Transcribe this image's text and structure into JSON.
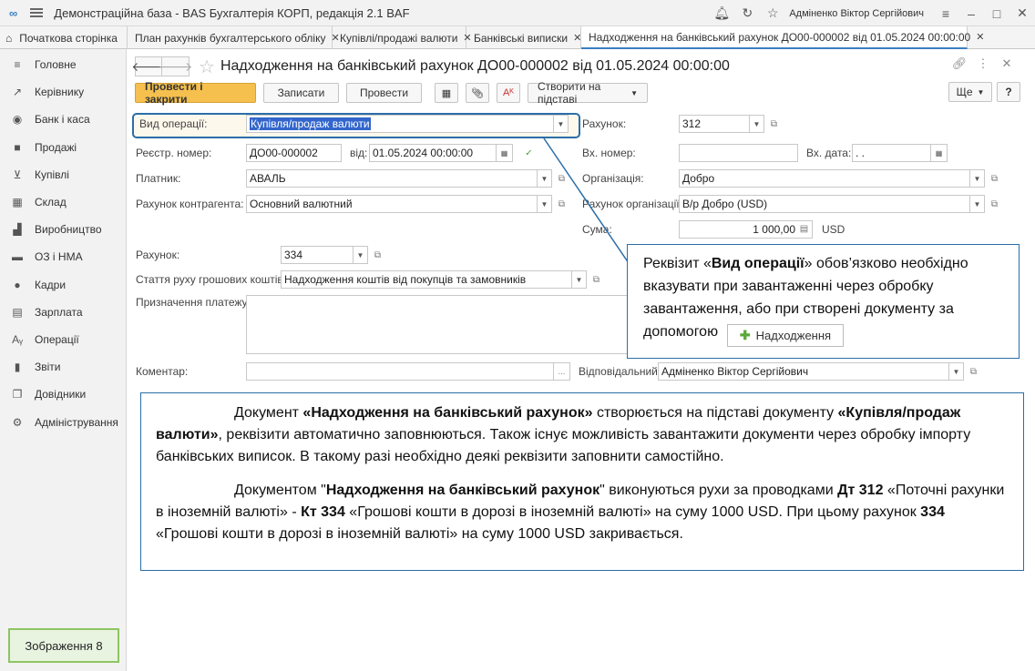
{
  "app": {
    "title": "Демонстраційна база - BAS Бухгалтерія КОРП, редакція 2.1 BAF",
    "user": "Адміненко Віктор Сергійович",
    "logo_text": "∞"
  },
  "tabs": [
    {
      "label": "Початкова сторінка",
      "icon": "home-icon"
    },
    {
      "label": "План рахунків бухгалтерського обліку"
    },
    {
      "label": "Купівлі/продажі валюти"
    },
    {
      "label": "Банківські виписки"
    },
    {
      "label": "Надходження на банківський рахунок ДО00-000002 від 01.05.2024 00:00:00"
    }
  ],
  "sidebar": {
    "items": [
      {
        "label": "Головне",
        "icon": "menu-icon"
      },
      {
        "label": "Керівнику",
        "icon": "chart-icon"
      },
      {
        "label": "Банк і каса",
        "icon": "coin-icon"
      },
      {
        "label": "Продажі",
        "icon": "bag-icon"
      },
      {
        "label": "Купівлі",
        "icon": "cart-icon"
      },
      {
        "label": "Склад",
        "icon": "grid-icon"
      },
      {
        "label": "Виробництво",
        "icon": "factory-icon"
      },
      {
        "label": "ОЗ і НМА",
        "icon": "truck-icon"
      },
      {
        "label": "Кадри",
        "icon": "person-icon"
      },
      {
        "label": "Зарплата",
        "icon": "salary-icon"
      },
      {
        "label": "Операції",
        "icon": "operations-icon"
      },
      {
        "label": "Звіти",
        "icon": "report-icon"
      },
      {
        "label": "Довідники",
        "icon": "book-icon"
      },
      {
        "label": "Адміністрування",
        "icon": "gear-icon"
      }
    ],
    "image_label": "Зображення 8"
  },
  "document": {
    "title": "Надходження на банківський рахунок ДО00-000002 від 01.05.2024 00:00:00"
  },
  "toolbar": {
    "post_close": "Провести і закрити",
    "save": "Записати",
    "post": "Провести",
    "create_based": "Створити на підставі",
    "more": "Ще",
    "help": "?"
  },
  "form": {
    "operation_type_label": "Вид операції:",
    "operation_type_value": "Купівля/продаж валюти",
    "account_label": "Рахунок:",
    "account_value": "312",
    "reg_number_label": "Реєстр. номер:",
    "reg_number_value": "ДО00-000002",
    "date_label": "від:",
    "date_value": "01.05.2024 00:00:00",
    "in_number_label": "Вх. номер:",
    "in_number_value": "",
    "in_date_label": "Вх. дата:",
    "in_date_value": " .  .",
    "payer_label": "Платник:",
    "payer_value": "АВАЛЬ",
    "organization_label": "Організація:",
    "organization_value": "Добро",
    "counterparty_account_label": "Рахунок контрагента:",
    "counterparty_account_value": "Основний валютний",
    "org_account_label": "Рахунок організації:",
    "org_account_value": "В/р Добро (USD)",
    "sum_label": "Сума:",
    "sum_value": "1 000,00",
    "currency": "USD",
    "gl_account_label": "Рахунок:",
    "gl_account_value": "334",
    "cashflow_label": "Стаття руху грошових коштів:",
    "cashflow_value": "Надходження коштів від покупців та замовників",
    "purpose_label": "Призначення платежу:",
    "purpose_value": "",
    "comment_label": "Коментар:",
    "comment_value": "",
    "responsible_label": "Відповідальний:",
    "responsible_value": "Адміненко Віктор Сергійович"
  },
  "callout": {
    "t1": "Реквізит «",
    "b1": "Вид операції",
    "t2": "» обов’язково необхідно вказувати при завантаженні через обробку завантаження, або при  створені документу за допомогою",
    "button_label": "Надходження"
  },
  "info": {
    "p1_t1": "Документ ",
    "p1_b1": "«Надходження на банківський рахунок»",
    "p1_t2": " створюється на підставі документу ",
    "p1_b2": "«Купівля/продаж валюти»",
    "p1_t3": ", реквізити автоматично заповнюються. Також існує можливість завантажити документи через обробку імпорту банківських виписок. В такому разі необхідно деякі реквізити заповнити самостійно.",
    "p2_t1": "Документом \"",
    "p2_b1": "Надходження на банківський рахунок",
    "p2_t2": "\" виконуються рухи за проводками  ",
    "p2_b2": "Дт 312",
    "p2_t3": " «Поточні рахунки в іноземній валюті» - ",
    "p2_b3": "Кт 334",
    "p2_t4": " «Грошові кошти в дорозі в іноземній валюті» на суму 1000 USD. При цьому рахунок ",
    "p2_b4": "334",
    "p2_t5": " «Грошові кошти в дорозі в іноземній валюті» на суму 1000 USD закривається."
  }
}
